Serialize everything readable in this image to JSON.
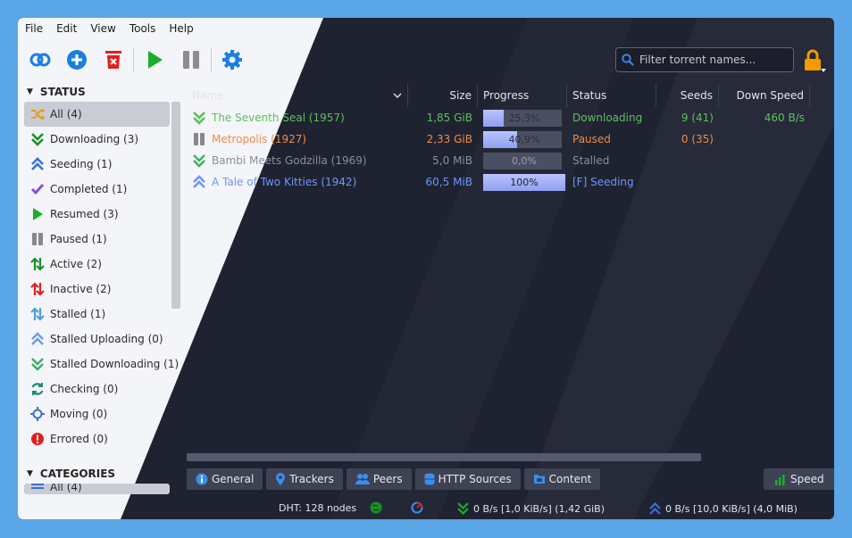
{
  "menu": [
    "File",
    "Edit",
    "View",
    "Tools",
    "Help"
  ],
  "toolbar": {
    "add_link": "link-icon",
    "add_torrent": "plus-circle-icon",
    "delete": "delete-icon",
    "resume": "play-icon",
    "pause": "pause-icon",
    "options": "gear-icon"
  },
  "search": {
    "placeholder": "Filter torrent names..."
  },
  "sidebar": {
    "status_title": "STATUS",
    "categories_title": "CATEGORIES",
    "categories_first": "All (4)",
    "items": [
      {
        "label": "All (4)",
        "icon": "shuffle-icon",
        "color": "#e0a020"
      },
      {
        "label": "Downloading (3)",
        "icon": "downloading-icon",
        "color": "#1c8f2a"
      },
      {
        "label": "Seeding (1)",
        "icon": "seeding-icon",
        "color": "#3d6fd6"
      },
      {
        "label": "Completed (1)",
        "icon": "check-icon",
        "color": "#8a4fd8"
      },
      {
        "label": "Resumed (3)",
        "icon": "play-icon",
        "color": "#1cae2a"
      },
      {
        "label": "Paused (1)",
        "icon": "pause-icon",
        "color": "#888888"
      },
      {
        "label": "Active (2)",
        "icon": "active-icon",
        "color": "#1c8f2a"
      },
      {
        "label": "Inactive (2)",
        "icon": "inactive-icon",
        "color": "#e02020"
      },
      {
        "label": "Stalled (1)",
        "icon": "stalled-icon",
        "color": "#4aa0d8"
      },
      {
        "label": "Stalled Uploading (0)",
        "icon": "stalled-uploading-icon",
        "color": "#6a9ae8"
      },
      {
        "label": "Stalled Downloading (1)",
        "icon": "stalled-downloading-icon",
        "color": "#3cb060"
      },
      {
        "label": "Checking (0)",
        "icon": "checking-icon",
        "color": "#1a8a78"
      },
      {
        "label": "Moving (0)",
        "icon": "moving-icon",
        "color": "#3d6fd6"
      },
      {
        "label": "Errored (0)",
        "icon": "error-icon",
        "color": "#e02020"
      }
    ]
  },
  "table": {
    "headers": [
      "Name",
      "Size",
      "Progress",
      "Status",
      "Seeds",
      "Down Speed"
    ],
    "rows": [
      {
        "name": "The Seventh Seal (1957)",
        "size": "1,85 GiB",
        "progress": 0.253,
        "progress_text": "25,3%",
        "status": "Downloading",
        "seeds": "9 (41)",
        "down": "460 B/s",
        "color": "#5cc05c",
        "icon": "downloading-icon"
      },
      {
        "name": "Metropolis (1927)",
        "size": "2,33 GiB",
        "progress": 0.409,
        "progress_text": "40,9%",
        "status": "Paused",
        "seeds": "0 (35)",
        "down": "",
        "color": "#f08a4a",
        "icon": "pause-icon"
      },
      {
        "name": "Bambi Meets Godzilla (1969)",
        "size": "5,0 MiB",
        "progress": 0.0,
        "progress_text": "0,0%",
        "status": "Stalled",
        "seeds": "",
        "down": "",
        "color": "#8a8f9c",
        "icon": "stalled-downloading-icon"
      },
      {
        "name": "A Tale of Two Kitties (1942)",
        "size": "60,5 MiB",
        "progress": 1.0,
        "progress_text": "100%",
        "status": "[F] Seeding",
        "seeds": "",
        "down": "",
        "color": "#6b96ff",
        "icon": "seeding-icon"
      }
    ]
  },
  "tabs": [
    "General",
    "Trackers",
    "Peers",
    "HTTP Sources",
    "Content"
  ],
  "speed_tab": "Speed",
  "status": {
    "dht": "DHT: 128 nodes",
    "down": "0 B/s [1,0 KiB/s] (1,42 GiB)",
    "up": "0 B/s [10,0 KiB/s] (4,0 MiB)"
  }
}
